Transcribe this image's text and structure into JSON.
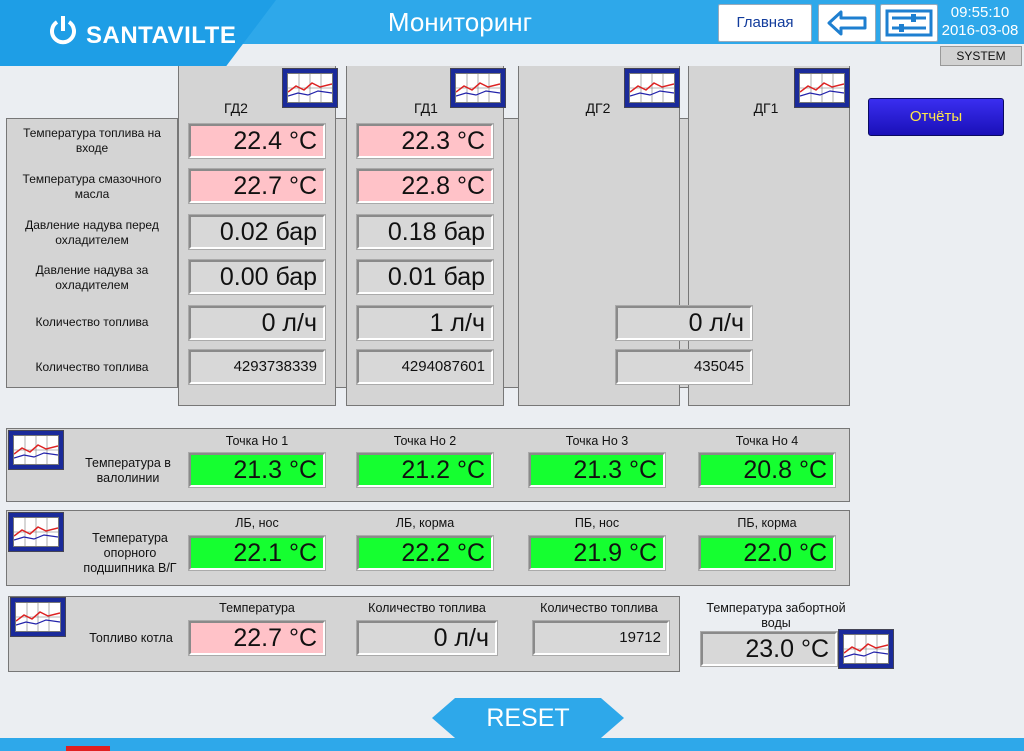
{
  "header": {
    "brand": "SANTAVILTE",
    "title": "Мониторинг",
    "home_label": "Главная",
    "time": "09:55:10",
    "date": "2016-03-08",
    "user": "SYSTEM"
  },
  "reports_label": "Отчёты",
  "engines": {
    "row_labels": [
      "Температура топлива на входе",
      "Температура смазочного масла",
      "Давление надува перед охладителем",
      "Давление надува за охладителем",
      "Количество топлива",
      "Количество топлива"
    ],
    "columns": [
      {
        "name": "ГД2",
        "values": [
          "22.4 °C",
          "22.7 °C",
          "0.02 бар",
          "0.00 бар",
          "0 л/ч",
          "4293738339"
        ]
      },
      {
        "name": "ГД1",
        "values": [
          "22.3 °C",
          "22.8 °C",
          "0.18 бар",
          "0.01 бар",
          "1 л/ч",
          "4294087601"
        ]
      },
      {
        "name": "ДГ2",
        "values": [
          "0 л/ч",
          "435045"
        ]
      },
      {
        "name": "ДГ1",
        "values": []
      }
    ]
  },
  "shaft_line": {
    "label": "Температура в валолинии",
    "points": [
      {
        "name": "Точка Но 1",
        "value": "21.3 °C"
      },
      {
        "name": "Точка Но 2",
        "value": "21.2 °C"
      },
      {
        "name": "Точка Но 3",
        "value": "21.3 °C"
      },
      {
        "name": "Точка Но 4",
        "value": "20.8 °C"
      }
    ]
  },
  "bearing": {
    "label": "Температура опорного подшипника В/Г",
    "points": [
      {
        "name": "ЛБ, нос",
        "value": "22.1 °C"
      },
      {
        "name": "ЛБ, корма",
        "value": "22.2 °C"
      },
      {
        "name": "ПБ, нос",
        "value": "21.9 °C"
      },
      {
        "name": "ПБ, корма",
        "value": "22.0 °C"
      }
    ]
  },
  "boiler": {
    "label": "Топливо котла",
    "temp_head": "Температура",
    "temp_value": "22.7 °C",
    "flow_head": "Количество топлива",
    "flow_value": "0 л/ч",
    "total_head": "Количество топлива",
    "total_value": "19712"
  },
  "seawater": {
    "label": "Температура забортной воды",
    "value": "23.0 °C"
  },
  "reset_label": "RESET",
  "colors": {
    "header": "#2ea8ea",
    "warm": "#ffc2c8",
    "ok": "#15ff30",
    "button": "#2a1ed8"
  }
}
